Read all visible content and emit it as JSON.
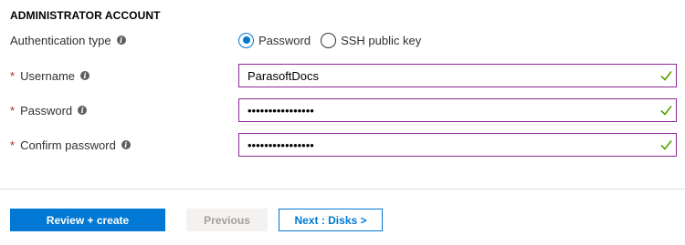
{
  "section": {
    "title": "ADMINISTRATOR ACCOUNT"
  },
  "auth_type": {
    "label": "Authentication type",
    "info_icon": "info-icon",
    "options": [
      {
        "label": "Password",
        "selected": true
      },
      {
        "label": "SSH public key",
        "selected": false
      }
    ]
  },
  "username": {
    "required_mark": "*",
    "label": "Username",
    "value": "ParasoftDocs",
    "valid_icon": "checkmark-icon"
  },
  "password": {
    "required_mark": "*",
    "label": "Password",
    "value": "••••••••••••••••",
    "valid_icon": "checkmark-icon"
  },
  "confirm_password": {
    "required_mark": "*",
    "label": "Confirm password",
    "value": "••••••••••••••••",
    "valid_icon": "checkmark-icon"
  },
  "footer": {
    "review_create_label": "Review + create",
    "previous_label": "Previous",
    "next_label": "Next : Disks >"
  },
  "colors": {
    "primary": "#0078d4",
    "required": "#a4262c",
    "field_border": "#8a2b96",
    "valid": "#57a300"
  }
}
